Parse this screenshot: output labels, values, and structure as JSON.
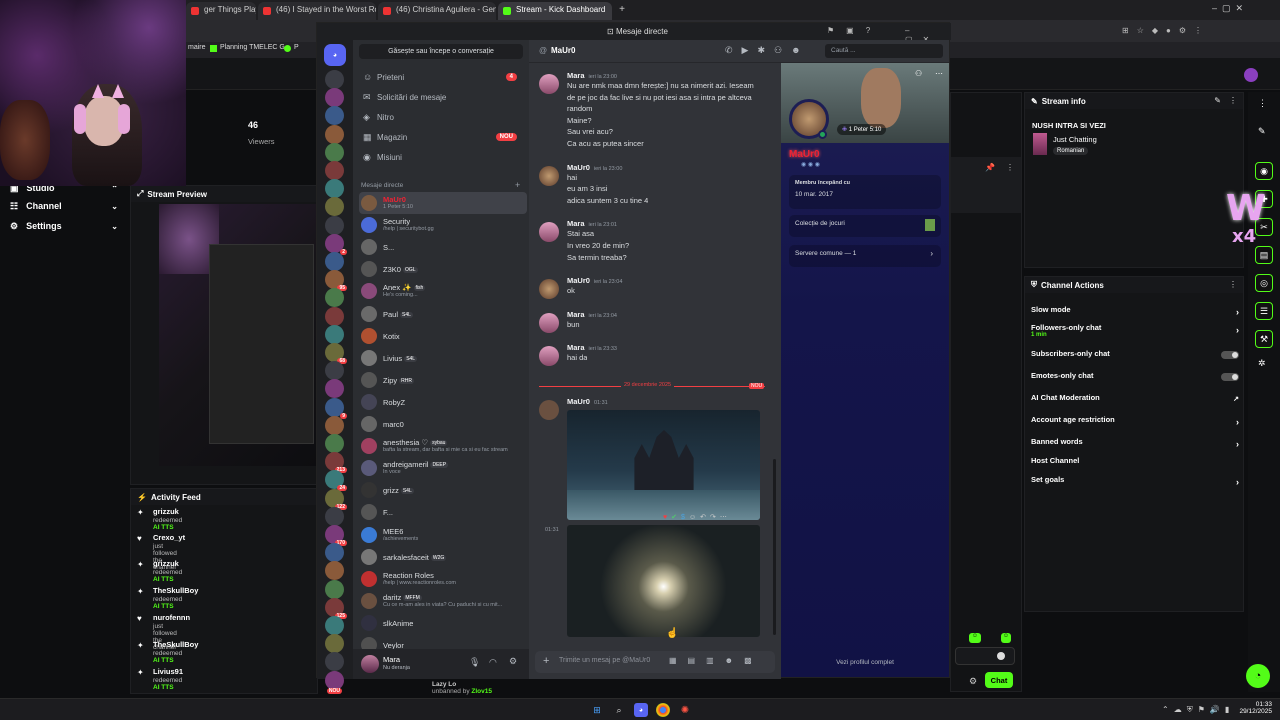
{
  "browser": {
    "tabs": [
      {
        "label": "ger Things Playlist |",
        "color": "#e33"
      },
      {
        "label": "(46) I Stayed in the Worst Roo",
        "color": "#e33"
      },
      {
        "label": "(46) Christina Aguilera - Genie",
        "color": "#e33"
      },
      {
        "label": "Stream - Kick Dashboard",
        "color": "#53fc18"
      }
    ],
    "bookmarks": [
      "maire",
      "Planning TMELEC G...",
      "P"
    ]
  },
  "kick": {
    "viewers": "46",
    "viewers_label": "Viewers",
    "nav": [
      "Studio",
      "Channel",
      "Settings"
    ],
    "stream_preview_title": "Stream Preview",
    "activity_feed_title": "Activity Feed",
    "activity": [
      {
        "name": "grizzuk",
        "action": "redeemed",
        "reward": "AI TTS",
        "icon": "gift"
      },
      {
        "name": "Crexo_yt",
        "action": "just followed the channel",
        "reward": "",
        "icon": "heart"
      },
      {
        "name": "grizzuk",
        "action": "redeemed",
        "reward": "AI TTS",
        "icon": "gift"
      },
      {
        "name": "TheSkullBoy",
        "action": "redeemed",
        "reward": "AI TTS",
        "icon": "gift"
      },
      {
        "name": "nurofennn",
        "action": "just followed the channel",
        "reward": "",
        "icon": "heart"
      },
      {
        "name": "TheSkullBoy",
        "action": "redeemed",
        "reward": "AI TTS",
        "icon": "gift"
      },
      {
        "name": "Livius91",
        "action": "redeemed",
        "reward": "AI TTS",
        "icon": "gift"
      }
    ],
    "bottom_line": {
      "name": "Lazy Lo",
      "text": "unbanned by",
      "by": "Zlov15"
    },
    "stream_info": {
      "title": "Stream info",
      "stream_title": "NUSH INTRA SI VEZI",
      "category": "Just Chatting",
      "tag": "Romanian"
    },
    "channel_actions": {
      "title": "Channel Actions",
      "items": [
        {
          "label": "Slow mode",
          "sub": "",
          "control": "chevron"
        },
        {
          "label": "Followers-only chat",
          "sub": "1 min",
          "control": "chevron"
        },
        {
          "label": "Subscribers-only chat",
          "sub": "",
          "control": "toggle"
        },
        {
          "label": "Emotes-only chat",
          "sub": "",
          "control": "toggle"
        },
        {
          "label": "AI Chat Moderation",
          "sub": "",
          "control": "external"
        },
        {
          "label": "Account age restriction",
          "sub": "",
          "control": "chevron"
        },
        {
          "label": "Banned words",
          "sub": "",
          "control": "chevron"
        },
        {
          "label": "Host Channel",
          "sub": "",
          "control": "none"
        },
        {
          "label": "Set goals",
          "sub": "",
          "control": "chevron"
        }
      ]
    },
    "chat_button": "Chat",
    "accent": "#53fc18"
  },
  "discord": {
    "window_title": "Mesaje directe",
    "search_placeholder": "Găsește sau începe o conversație",
    "top_search": "Caută ...",
    "nav": [
      {
        "label": "Prieteni",
        "badge": "4",
        "icon": "friends-icon"
      },
      {
        "label": "Solicitări de mesaje",
        "badge": "",
        "icon": "mail-icon"
      },
      {
        "label": "Nitro",
        "badge": "",
        "icon": "nitro-icon"
      },
      {
        "label": "Magazin",
        "badge": "NOU",
        "icon": "shop-icon"
      },
      {
        "label": "Misiuni",
        "badge": "",
        "icon": "quest-icon"
      }
    ],
    "dm_header": "Mesaje directe",
    "dms": [
      {
        "name": "MaUr0",
        "status": "1 Peter 5:10",
        "color": "#7a5a40"
      },
      {
        "name": "Security",
        "status": "/help | securitybot.gg",
        "color": "#4b6bd8"
      },
      {
        "name": "S...",
        "status": "",
        "color": "#666"
      },
      {
        "name": "Z3K0",
        "status": "",
        "tag": "OGL",
        "color": "#555"
      },
      {
        "name": "Anex ✨",
        "status": "He's coming...",
        "tag": "fish",
        "color": "#8a4a7a"
      },
      {
        "name": "Paul",
        "status": "",
        "tag": "S4L",
        "color": "#6a6a6a"
      },
      {
        "name": "Kotix",
        "status": "",
        "color": "#b05030"
      },
      {
        "name": "Livius",
        "status": "",
        "tag": "S4L",
        "color": "#777"
      },
      {
        "name": "Zipy",
        "status": "",
        "tag": "RHR",
        "color": "#555"
      },
      {
        "name": "RobyZ",
        "status": "",
        "color": "#445"
      },
      {
        "name": "marc0",
        "status": "",
        "color": "#666"
      },
      {
        "name": "anesthesia ♡",
        "status": "bafta la stream, dar bafta si mie ca si eu fac stream",
        "tag": "sybau",
        "color": "#a04060"
      },
      {
        "name": "andreigameril",
        "status": "În voce",
        "tag": "DEEP",
        "color": "#5a5a7a"
      },
      {
        "name": "grizz",
        "status": "",
        "tag": "S4L",
        "color": "#333"
      },
      {
        "name": "F...",
        "status": "",
        "color": "#555"
      },
      {
        "name": "MEE6",
        "status": "/achievements",
        "color": "#3a7bd5"
      },
      {
        "name": "sarkalesfaceit",
        "status": "",
        "tag": "W2G",
        "color": "#777"
      },
      {
        "name": "Reaction Roles",
        "status": "/help | www.reactionroles.com",
        "color": "#c03030"
      },
      {
        "name": "daritz",
        "status": "Cu ce m-am ales in viata? Cu paduchi si cu mit...",
        "tag": "MFFM",
        "color": "#6a5040"
      },
      {
        "name": "slkAnime",
        "status": "",
        "color": "#303040"
      },
      {
        "name": "Veylor",
        "status": "",
        "color": "#505050"
      }
    ],
    "user": {
      "name": "Mara",
      "status": "Nu deranja"
    },
    "chat_user": "MaUr0",
    "messages": [
      {
        "author": "Mara",
        "time": "ieri la 23:00",
        "lines": [
          "Nu are nmk maa dmn ferește:] nu sa nimerit azi. Ieseam",
          "de pe joc da fac live si nu pot iesi asa si intra pe altceva",
          "random",
          "Maine?",
          "Sau vrei acu?",
          "Ca acu as putea sincer"
        ]
      },
      {
        "author": "MaUr0",
        "time": "ieri la 23:00",
        "lines": [
          "hai",
          "eu am 3 insi",
          "adica suntem 3 cu tine 4"
        ]
      },
      {
        "author": "Mara",
        "time": "ieri la 23:01",
        "lines": [
          "Stai asa",
          "In vreo 20 de min?",
          "Sa termin treaba?"
        ]
      },
      {
        "author": "MaUr0",
        "time": "ieri la 23:04",
        "lines": [
          "ok"
        ]
      },
      {
        "author": "Mara",
        "time": "ieri la 23:04",
        "lines": [
          "bun"
        ]
      },
      {
        "author": "Mara",
        "time": "ieri la 23:33",
        "lines": [
          "hai da"
        ]
      }
    ],
    "date_divider": "29 decembrie 2025",
    "new_label": "NOU",
    "last_author": "MaUr0",
    "last_time": "01:31",
    "second_time": "01:31",
    "message_placeholder": "Trimite un mesaj pe @MaUr0",
    "profile": {
      "name": "MaUr0",
      "status": "1 Peter 5:10",
      "member_since_label": "Membru începând cu",
      "member_since": "10 mar. 2017",
      "collection": "Colecție de jocuri",
      "servers": "Servere comune — 1",
      "full_profile": "Vezi profilul complet"
    },
    "guild_badges": [
      "",
      "",
      "",
      "",
      "",
      "",
      "",
      "",
      "",
      "2",
      "",
      "95",
      "",
      "",
      "",
      "68",
      "",
      "",
      "9",
      "",
      "",
      "213",
      "24",
      "122",
      "",
      "170",
      "",
      "",
      "",
      "125",
      "",
      "",
      "",
      "NOU"
    ]
  },
  "taskbar": {
    "time": "01:33",
    "date": "29/12/2025"
  }
}
